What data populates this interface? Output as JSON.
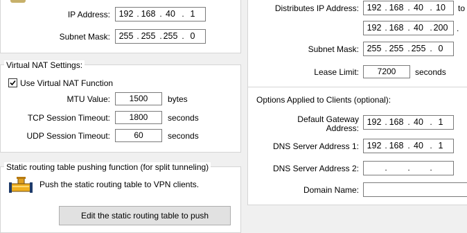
{
  "left": {
    "ip_label": "IP Address:",
    "ip": [
      "192",
      "168",
      "40",
      "1"
    ],
    "subnet_label": "Subnet Mask:",
    "subnet": [
      "255",
      "255",
      "255",
      "0"
    ],
    "nat_title": "Virtual NAT Settings:",
    "use_nat_label": "Use Virtual NAT Function",
    "use_nat_checked": true,
    "mtu_label": "MTU Value:",
    "mtu_value": "1500",
    "mtu_unit": "bytes",
    "tcp_label": "TCP Session Timeout:",
    "tcp_value": "1800",
    "tcp_unit": "seconds",
    "udp_label": "UDP Session Timeout:",
    "udp_value": "60",
    "udp_unit": "seconds",
    "static_title": "Static routing table pushing function (for split tunneling)",
    "static_desc": "Push the static routing table to VPN clients.",
    "edit_button": "Edit the static routing table to push"
  },
  "right": {
    "dist_label": "Distributes IP Address:",
    "dist_from": [
      "192",
      "168",
      "40",
      "10"
    ],
    "to_label": "to",
    "dist_to": [
      "192",
      "168",
      "40",
      "200"
    ],
    "subnet_label": "Subnet Mask:",
    "subnet": [
      "255",
      "255",
      "255",
      "0"
    ],
    "lease_label": "Lease Limit:",
    "lease_value": "7200",
    "lease_unit": "seconds",
    "options_title": "Options Applied to Clients (optional):",
    "gateway_label_1": "Default Gateway",
    "gateway_label_2": "Address:",
    "gateway": [
      "192",
      "168",
      "40",
      "1"
    ],
    "dns1_label": "DNS Server Address 1:",
    "dns1": [
      "192",
      "168",
      "40",
      "1"
    ],
    "dns2_label": "DNS Server Address 2:",
    "dns2": [
      "",
      "",
      "",
      ""
    ],
    "domain_label": "Domain Name:",
    "domain_value": ""
  },
  "icons": {
    "pipe": "pipe-tee-icon",
    "check": "checkmark-icon"
  }
}
